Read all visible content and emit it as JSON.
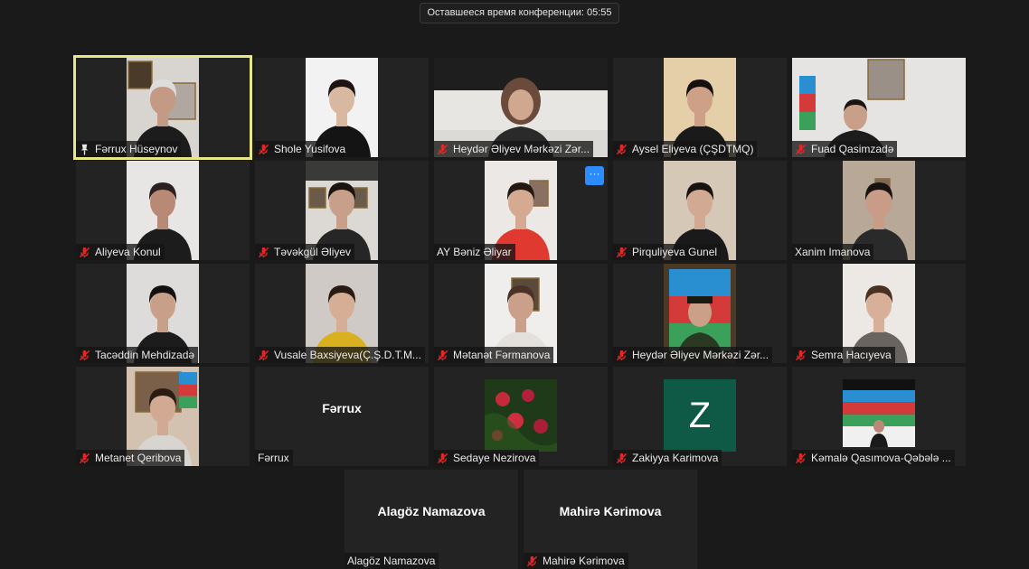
{
  "meeting": {
    "remaining_time": "Оставшееся время конференции: 05:55"
  },
  "participants": [
    {
      "name": "Fərrux Hüseynov",
      "status_icon": "pin-icon",
      "video": "woman-glasses-portrait"
    },
    {
      "name": "Shole Yusifova",
      "status_icon": "mic-muted-icon",
      "video": "woman-white-wall"
    },
    {
      "name": "Heydər Əliyev Mərkəzi Zər...",
      "status_icon": "mic-muted-icon",
      "video": "woman-office-desk"
    },
    {
      "name": "Aysel Eliyeva (ÇŞDTMQ)",
      "status_icon": "mic-muted-icon",
      "video": "woman-long-hair"
    },
    {
      "name": "Fuad Qasimzadə",
      "status_icon": "mic-muted-icon",
      "video": "man-office-flag"
    },
    {
      "name": "Aliyeva Konul",
      "status_icon": "mic-muted-icon",
      "video": "person-dark-shirt"
    },
    {
      "name": "Təvəkgül Əliyev",
      "status_icon": "mic-muted-icon",
      "video": "man-suit-portrait"
    },
    {
      "name": "AY Bəniz Əliyar",
      "status_icon": "",
      "video": "woman-red-top",
      "more_button": "···"
    },
    {
      "name": "Pirquliyeva Gunel",
      "status_icon": "mic-muted-icon",
      "video": "woman-dark-hair"
    },
    {
      "name": "Xanim Imanova",
      "status_icon": "",
      "video": "woman-home"
    },
    {
      "name": "Tacəddin Mehdizadə",
      "status_icon": "mic-muted-icon",
      "video": "man-dark-jacket"
    },
    {
      "name": "Vusale Baxsiyeva(Ç.Ş.D.T.M...",
      "status_icon": "mic-muted-icon",
      "video": "woman-yellow-jacket"
    },
    {
      "name": "Mətanət Fərmanova",
      "status_icon": "mic-muted-icon",
      "video": "woman-portrait-wall"
    },
    {
      "name": "Heydər Əliyev Mərkəzi Zər...",
      "status_icon": "mic-muted-icon",
      "video": "military-portrait-flag"
    },
    {
      "name": "Semra Hacıyeva",
      "status_icon": "mic-muted-icon",
      "video": "woman-light-room"
    },
    {
      "name": "Metanet Qeribova",
      "status_icon": "mic-muted-icon",
      "video": "woman-portrait-flag"
    },
    {
      "name": "Fərrux",
      "status_icon": "",
      "video": "",
      "display_name": "Fərrux"
    },
    {
      "name": "Sedaye Nezirova",
      "status_icon": "mic-muted-icon",
      "video": "roses-photo"
    },
    {
      "name": "Zakiyya Karimova",
      "status_icon": "mic-muted-icon",
      "video": "",
      "avatar_letter": "Z"
    },
    {
      "name": "Kəmalə Qasımova-Qəbələ ...",
      "status_icon": "mic-muted-icon",
      "video": "flag-backdrop-person"
    },
    {
      "name": "Alagöz Namazova",
      "status_icon": "",
      "video": "",
      "display_name": "Alagöz Namazova"
    },
    {
      "name": "Mahirə Kərimova",
      "status_icon": "mic-muted-icon",
      "video": "",
      "display_name": "Mahirə Kərimova"
    }
  ],
  "colors": {
    "background": "#1a1a1a",
    "tile": "#232323",
    "active_speaker_border": "#e8e686",
    "muted_icon": "#e02828",
    "avatar_green": "#0f5a46",
    "more_button": "#2d8cff"
  }
}
